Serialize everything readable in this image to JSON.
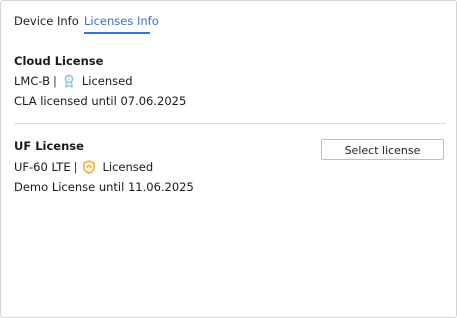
{
  "tabs": [
    {
      "label": "Device Info",
      "active": false
    },
    {
      "label": "Licenses Info",
      "active": true
    }
  ],
  "accent_color": "#3b6fd4",
  "cloud_license": {
    "title": "Cloud License",
    "device": "LMC-B",
    "separator": "|",
    "status_icon": "ribbon-award-icon",
    "status": "Licensed",
    "expiry": "CLA licensed until 07.06.2025"
  },
  "uf_license": {
    "title": "UF License",
    "device": "UF-60 LTE",
    "separator": "|",
    "status_icon": "shield-icon",
    "status": "Licensed",
    "expiry": "Demo License until 11.06.2025",
    "select_button": "Select license"
  }
}
